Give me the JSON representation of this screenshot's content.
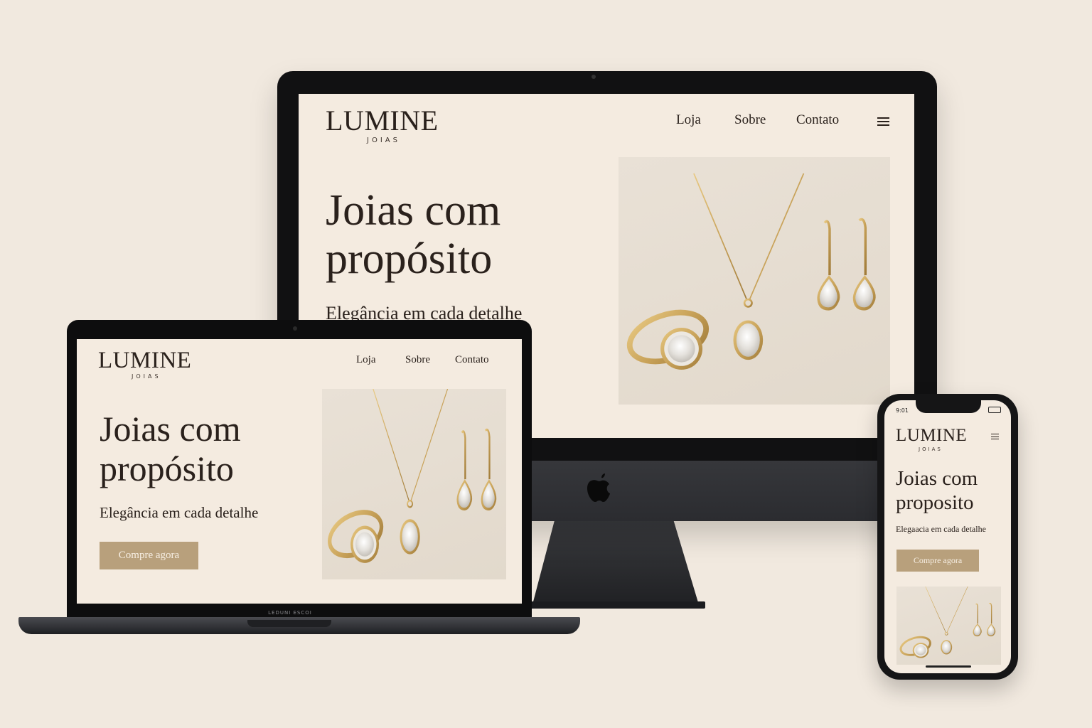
{
  "brand": {
    "name": "LUMINE",
    "tagline": "JOIAS"
  },
  "desktop": {
    "nav": [
      "Loja",
      "Sobre",
      "Contato"
    ],
    "hero_title_line1": "Joias com",
    "hero_title_line2": "propósito",
    "hero_subtitle": "Elegância em cada detalhe"
  },
  "laptop": {
    "nav": [
      "Loja",
      "Sobre",
      "Contato"
    ],
    "hero_title_line1": "Joias com",
    "hero_title_line2": "propósito",
    "hero_subtitle": "Elegância em cada detalhe",
    "cta": "Compre agora",
    "label": "LEDUNI ESCOI"
  },
  "phone": {
    "time": "9:01",
    "hero_title_line1": "Joias com",
    "hero_title_line2": "proposito",
    "hero_subtitle": "Elegaacia em cada detalhe",
    "cta": "Compre agora"
  },
  "icons": {
    "menu": "hamburger-icon",
    "brand_logo": "apple-logo-icon"
  },
  "colors": {
    "background": "#f1e9df",
    "screen": "#f4ebe0",
    "cta": "#b8a07c",
    "gold": "#c9a35a",
    "text": "#2a211c"
  }
}
